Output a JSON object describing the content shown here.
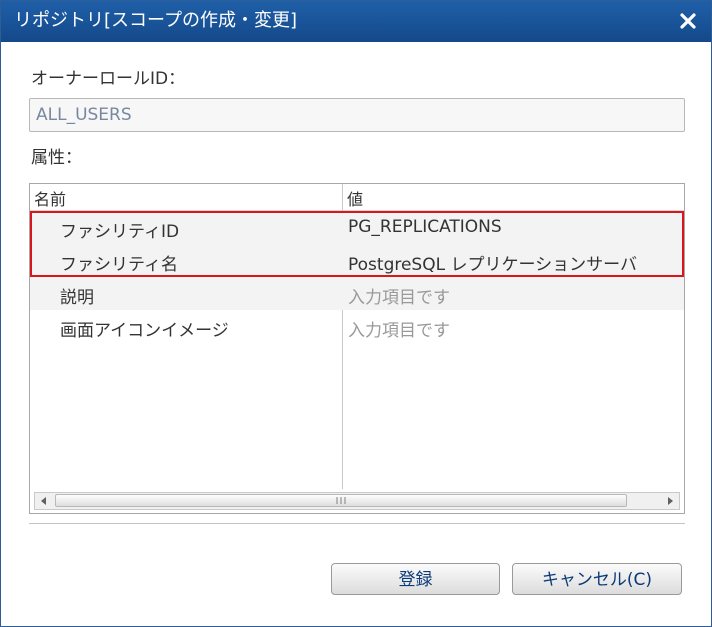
{
  "dialog": {
    "title": "リポジトリ[スコープの作成・変更]",
    "close_icon": "close-icon"
  },
  "owner_role": {
    "label": "オーナーロールID：",
    "value": "ALL_USERS"
  },
  "attributes": {
    "label": "属性：",
    "columns": [
      "名前",
      "値"
    ],
    "rows": [
      {
        "name": "ファシリティID",
        "value": "PG_REPLICATIONS",
        "placeholder": false
      },
      {
        "name": "ファシリティ名",
        "value": "PostgreSQL レプリケーションサーバ",
        "placeholder": false
      },
      {
        "name": "説明",
        "value": "入力項目です",
        "placeholder": true
      },
      {
        "name": "画面アイコンイメージ",
        "value": "入力項目です",
        "placeholder": true
      }
    ],
    "scroll_grip": "III"
  },
  "buttons": {
    "register": "登録",
    "cancel": "キャンセル(C)"
  },
  "colors": {
    "titlebar": "#1a56a0",
    "highlight": "#d8161e",
    "button_text": "#0b3a78"
  }
}
